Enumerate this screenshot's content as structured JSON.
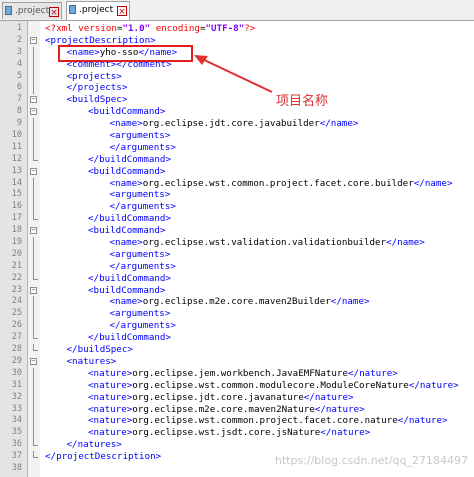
{
  "tabs": [
    {
      "label": ".project",
      "active": false
    },
    {
      "label": ".project",
      "active": true
    }
  ],
  "annotation": {
    "text": "项目名称",
    "color": "#e03030"
  },
  "watermark": "https://blog.csdn.net/qq_27184497",
  "colors": {
    "tag": "#0000ff",
    "attr": "#ff0000",
    "value": "#8000ff",
    "text": "#000000"
  },
  "lines": [
    {
      "n": "1",
      "indent": 0,
      "fold": "none",
      "segs": [
        [
          "pi",
          "<?xml "
        ],
        [
          "attr",
          "version"
        ],
        [
          "plain",
          "="
        ],
        [
          "val",
          "\"1.0\""
        ],
        [
          "plain",
          " "
        ],
        [
          "attr",
          "encoding"
        ],
        [
          "plain",
          "="
        ],
        [
          "val",
          "\"UTF-8\""
        ],
        [
          "pi",
          "?>"
        ]
      ]
    },
    {
      "n": "2",
      "indent": 0,
      "fold": "open",
      "segs": [
        [
          "tag",
          "<projectDescription>"
        ]
      ]
    },
    {
      "n": "3",
      "indent": 1,
      "fold": "bar",
      "segs": [
        [
          "tag",
          "<name>"
        ],
        [
          "plain",
          "yho-sso"
        ],
        [
          "tag",
          "</name>"
        ]
      ]
    },
    {
      "n": "4",
      "indent": 1,
      "fold": "bar",
      "segs": [
        [
          "tag",
          "<comment></comment>"
        ]
      ]
    },
    {
      "n": "5",
      "indent": 1,
      "fold": "bar",
      "segs": [
        [
          "tag",
          "<projects>"
        ]
      ]
    },
    {
      "n": "6",
      "indent": 1,
      "fold": "bar",
      "segs": [
        [
          "tag",
          "</projects>"
        ]
      ]
    },
    {
      "n": "7",
      "indent": 1,
      "fold": "open",
      "segs": [
        [
          "tag",
          "<buildSpec>"
        ]
      ]
    },
    {
      "n": "8",
      "indent": 2,
      "fold": "open",
      "segs": [
        [
          "tag",
          "<buildCommand>"
        ]
      ]
    },
    {
      "n": "9",
      "indent": 3,
      "fold": "bar",
      "segs": [
        [
          "tag",
          "<name>"
        ],
        [
          "plain",
          "org.eclipse.jdt.core.javabuilder"
        ],
        [
          "tag",
          "</name>"
        ]
      ]
    },
    {
      "n": "10",
      "indent": 3,
      "fold": "bar",
      "segs": [
        [
          "tag",
          "<arguments>"
        ]
      ]
    },
    {
      "n": "11",
      "indent": 3,
      "fold": "bar",
      "segs": [
        [
          "tag",
          "</arguments>"
        ]
      ]
    },
    {
      "n": "12",
      "indent": 2,
      "fold": "end",
      "segs": [
        [
          "tag",
          "</buildCommand>"
        ]
      ]
    },
    {
      "n": "13",
      "indent": 2,
      "fold": "open",
      "segs": [
        [
          "tag",
          "<buildCommand>"
        ]
      ]
    },
    {
      "n": "14",
      "indent": 3,
      "fold": "bar",
      "segs": [
        [
          "tag",
          "<name>"
        ],
        [
          "plain",
          "org.eclipse.wst.common.project.facet.core.builder"
        ],
        [
          "tag",
          "</name>"
        ]
      ]
    },
    {
      "n": "15",
      "indent": 3,
      "fold": "bar",
      "segs": [
        [
          "tag",
          "<arguments>"
        ]
      ]
    },
    {
      "n": "16",
      "indent": 3,
      "fold": "bar",
      "segs": [
        [
          "tag",
          "</arguments>"
        ]
      ]
    },
    {
      "n": "17",
      "indent": 2,
      "fold": "end",
      "segs": [
        [
          "tag",
          "</buildCommand>"
        ]
      ]
    },
    {
      "n": "18",
      "indent": 2,
      "fold": "open",
      "segs": [
        [
          "tag",
          "<buildCommand>"
        ]
      ]
    },
    {
      "n": "19",
      "indent": 3,
      "fold": "bar",
      "segs": [
        [
          "tag",
          "<name>"
        ],
        [
          "plain",
          "org.eclipse.wst.validation.validationbuilder"
        ],
        [
          "tag",
          "</name>"
        ]
      ]
    },
    {
      "n": "20",
      "indent": 3,
      "fold": "bar",
      "segs": [
        [
          "tag",
          "<arguments>"
        ]
      ]
    },
    {
      "n": "21",
      "indent": 3,
      "fold": "bar",
      "segs": [
        [
          "tag",
          "</arguments>"
        ]
      ]
    },
    {
      "n": "22",
      "indent": 2,
      "fold": "end",
      "segs": [
        [
          "tag",
          "</buildCommand>"
        ]
      ]
    },
    {
      "n": "23",
      "indent": 2,
      "fold": "open",
      "segs": [
        [
          "tag",
          "<buildCommand>"
        ]
      ]
    },
    {
      "n": "24",
      "indent": 3,
      "fold": "bar",
      "segs": [
        [
          "tag",
          "<name>"
        ],
        [
          "plain",
          "org.eclipse.m2e.core.maven2Builder"
        ],
        [
          "tag",
          "</name>"
        ]
      ]
    },
    {
      "n": "25",
      "indent": 3,
      "fold": "bar",
      "segs": [
        [
          "tag",
          "<arguments>"
        ]
      ]
    },
    {
      "n": "26",
      "indent": 3,
      "fold": "bar",
      "segs": [
        [
          "tag",
          "</arguments>"
        ]
      ]
    },
    {
      "n": "27",
      "indent": 2,
      "fold": "end",
      "segs": [
        [
          "tag",
          "</buildCommand>"
        ]
      ]
    },
    {
      "n": "28",
      "indent": 1,
      "fold": "end",
      "segs": [
        [
          "tag",
          "</buildSpec>"
        ]
      ]
    },
    {
      "n": "29",
      "indent": 1,
      "fold": "open",
      "segs": [
        [
          "tag",
          "<natures>"
        ]
      ]
    },
    {
      "n": "30",
      "indent": 2,
      "fold": "bar",
      "segs": [
        [
          "tag",
          "<nature>"
        ],
        [
          "plain",
          "org.eclipse.jem.workbench.JavaEMFNature"
        ],
        [
          "tag",
          "</nature>"
        ]
      ]
    },
    {
      "n": "31",
      "indent": 2,
      "fold": "bar",
      "segs": [
        [
          "tag",
          "<nature>"
        ],
        [
          "plain",
          "org.eclipse.wst.common.modulecore.ModuleCoreNature"
        ],
        [
          "tag",
          "</nature>"
        ]
      ]
    },
    {
      "n": "32",
      "indent": 2,
      "fold": "bar",
      "segs": [
        [
          "tag",
          "<nature>"
        ],
        [
          "plain",
          "org.eclipse.jdt.core.javanature"
        ],
        [
          "tag",
          "</nature>"
        ]
      ]
    },
    {
      "n": "33",
      "indent": 2,
      "fold": "bar",
      "segs": [
        [
          "tag",
          "<nature>"
        ],
        [
          "plain",
          "org.eclipse.m2e.core.maven2Nature"
        ],
        [
          "tag",
          "</nature>"
        ]
      ]
    },
    {
      "n": "34",
      "indent": 2,
      "fold": "bar",
      "segs": [
        [
          "tag",
          "<nature>"
        ],
        [
          "plain",
          "org.eclipse.wst.common.project.facet.core.nature"
        ],
        [
          "tag",
          "</nature>"
        ]
      ]
    },
    {
      "n": "35",
      "indent": 2,
      "fold": "bar",
      "segs": [
        [
          "tag",
          "<nature>"
        ],
        [
          "plain",
          "org.eclipse.wst.jsdt.core.jsNature"
        ],
        [
          "tag",
          "</nature>"
        ]
      ]
    },
    {
      "n": "36",
      "indent": 1,
      "fold": "end",
      "segs": [
        [
          "tag",
          "</natures>"
        ]
      ]
    },
    {
      "n": "37",
      "indent": 0,
      "fold": "end",
      "segs": [
        [
          "tag",
          "</projectDescription>"
        ]
      ]
    },
    {
      "n": "38",
      "indent": 0,
      "fold": "none",
      "segs": []
    }
  ]
}
